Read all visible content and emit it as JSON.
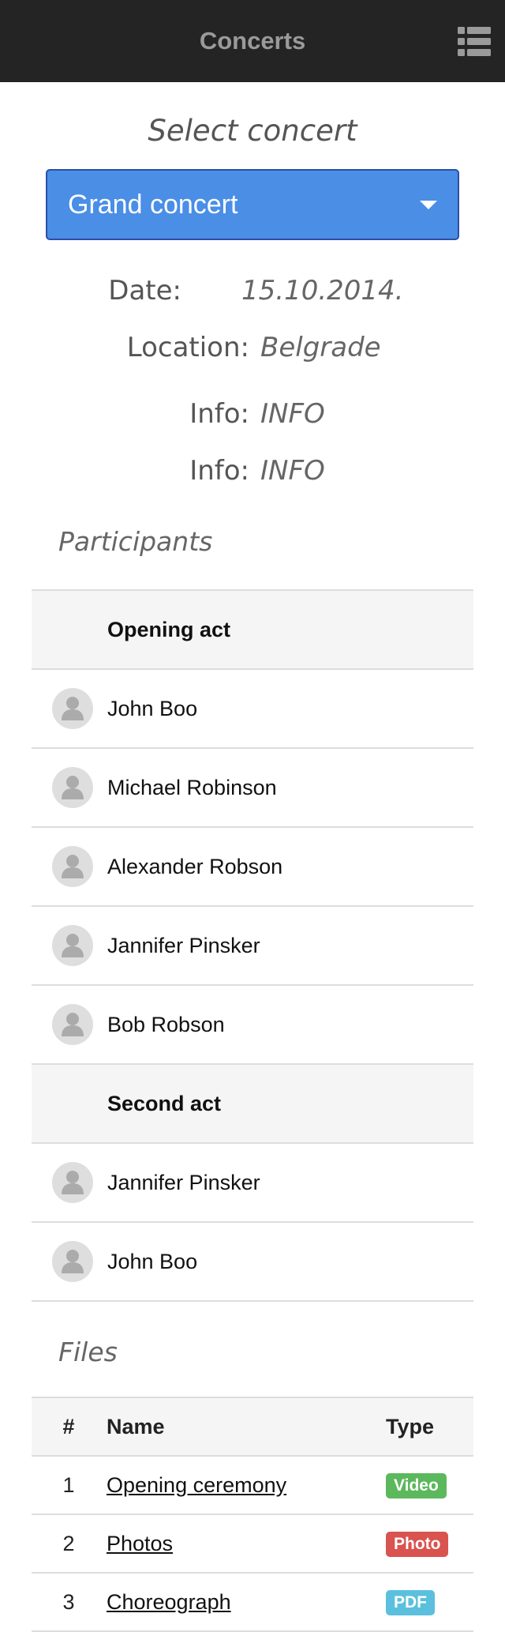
{
  "header": {
    "title": "Concerts"
  },
  "select_heading": "Select concert",
  "concert_select": {
    "value": "Grand concert"
  },
  "details": [
    {
      "label": "Date:",
      "value": "15.10.2014."
    },
    {
      "label": "Location:",
      "value": "Belgrade"
    },
    {
      "label": "Info:",
      "value": "INFO"
    },
    {
      "label": "Info:",
      "value": "INFO"
    }
  ],
  "participants": {
    "heading": "Participants",
    "groups": [
      {
        "title": "Opening act",
        "members": [
          "John Boo",
          "Michael Robinson",
          "Alexander Robson",
          "Jannifer Pinsker",
          "Bob Robson"
        ]
      },
      {
        "title": "Second act",
        "members": [
          "Jannifer Pinsker",
          "John Boo"
        ]
      }
    ]
  },
  "files": {
    "heading": "Files",
    "columns": [
      "#",
      "Name",
      "Type"
    ],
    "rows": [
      {
        "num": "1",
        "name": "Opening ceremony",
        "type": "Video",
        "color": "#5cb85c"
      },
      {
        "num": "2",
        "name": "Photos",
        "type": "Photo",
        "color": "#d9534f"
      },
      {
        "num": "3",
        "name": "Choreograph",
        "type": "PDF",
        "color": "#5bc0de"
      }
    ]
  },
  "icons": {
    "menu": "list-menu-icon",
    "avatar": "user-silhouette-icon"
  }
}
